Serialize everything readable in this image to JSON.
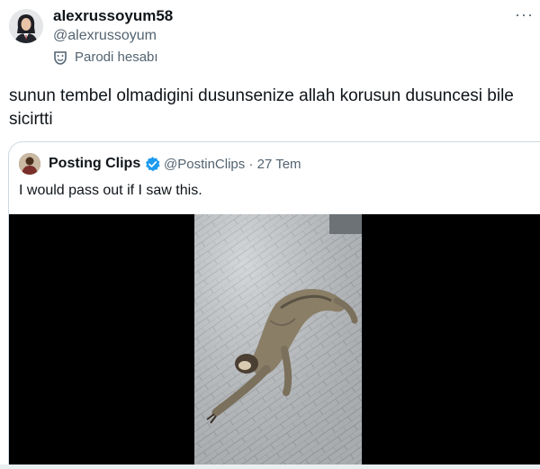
{
  "author": {
    "display_name": "alexrussoyum58",
    "handle": "@alexrussoyum",
    "parody_label": "Parodi hesabı",
    "avatar_icon": "profile-avatar"
  },
  "tweet": {
    "text": "sunun tembel olmadigini dusunsenize allah korusun dusuncesi bile sicirtti",
    "more_icon": "more-options-icon"
  },
  "quoted": {
    "display_name": "Posting Clips",
    "handle": "@PostinClips",
    "separator": "·",
    "time": "27 Tem",
    "text": "I would pass out if I saw this.",
    "verified_color": "#1d9bf0",
    "media": {
      "type": "video",
      "letterbox_color": "#000000"
    }
  }
}
